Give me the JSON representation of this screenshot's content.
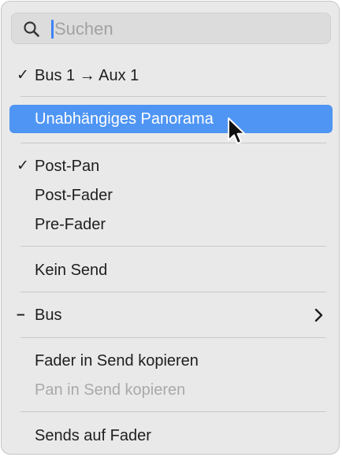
{
  "search": {
    "placeholder": "Suchen",
    "value": "",
    "icon": "magnifier-icon"
  },
  "menu": {
    "send_route": {
      "check": "✓",
      "label": "Bus 1 → Aux 1"
    },
    "independent_pan": {
      "label": "Unabhängiges Panorama",
      "state": "highlighted"
    },
    "post_pan": {
      "check": "✓",
      "label": "Post-Pan"
    },
    "post_fader": {
      "label": "Post-Fader"
    },
    "pre_fader": {
      "label": "Pre-Fader"
    },
    "no_send": {
      "label": "Kein Send"
    },
    "bus": {
      "mark": "–",
      "label": "Bus",
      "submenu_icon": "chevron-right-icon"
    },
    "copy_fader": {
      "label": "Fader in Send kopieren"
    },
    "copy_pan": {
      "label": "Pan in Send kopieren",
      "state": "disabled"
    },
    "sends_on_fader": {
      "label": "Sends auf Fader"
    }
  },
  "colors": {
    "menu_background": "#e9e9e9",
    "highlight": "#4f95f3",
    "text": "#1e1e1e",
    "disabled_text": "#a9a9a9",
    "caret": "#3d82f6"
  }
}
